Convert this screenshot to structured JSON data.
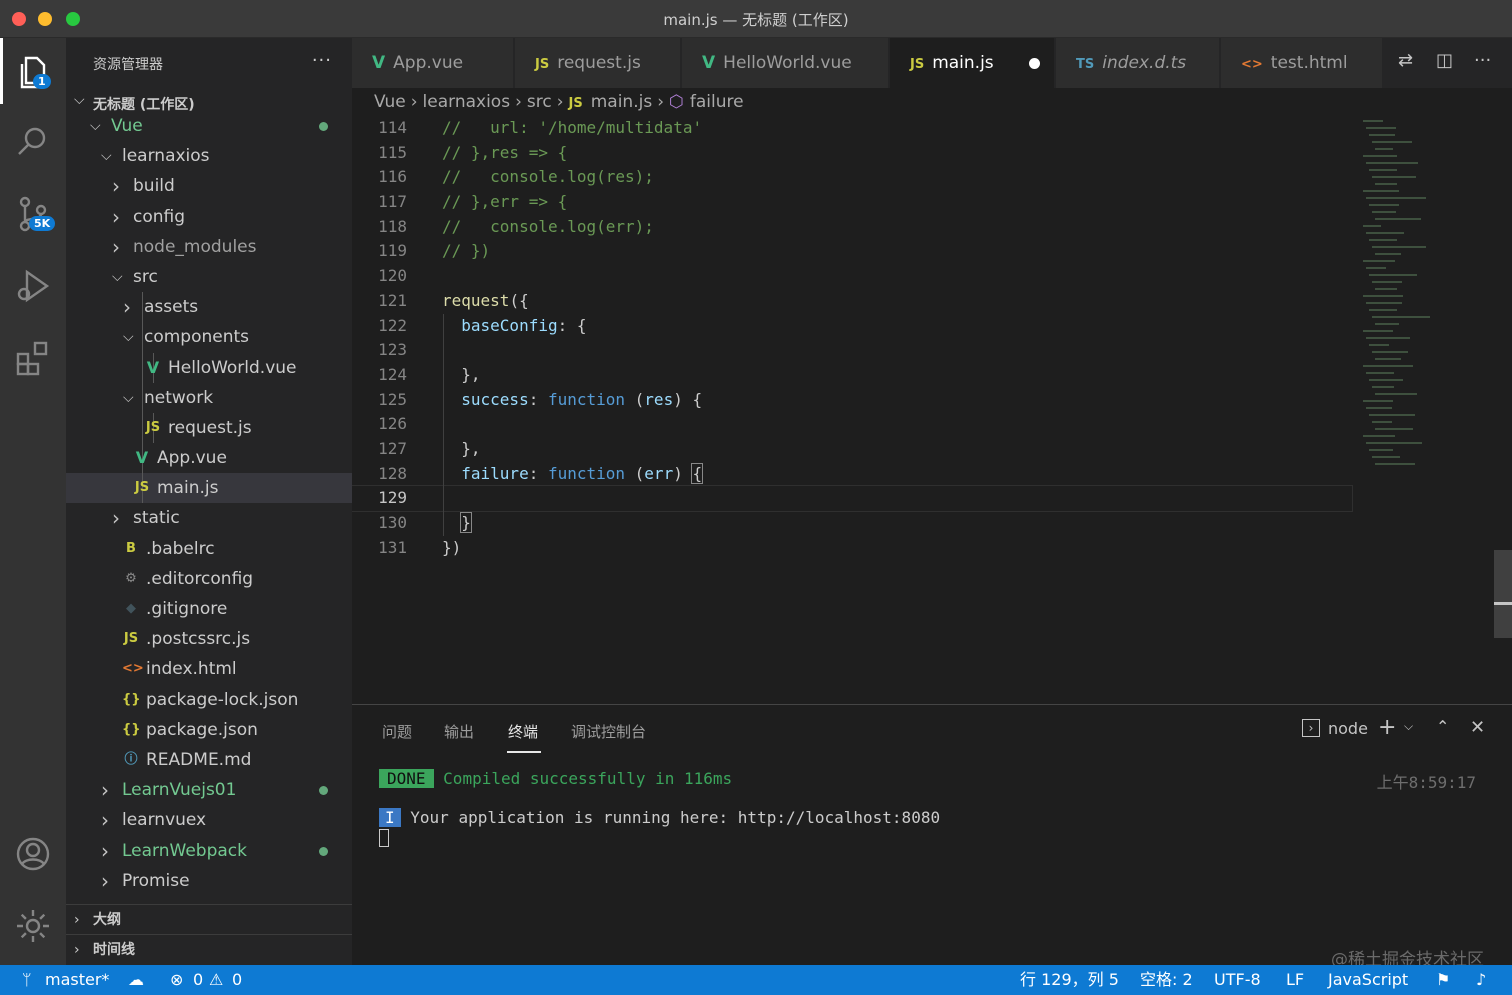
{
  "window": {
    "title": "main.js — 无标题 (工作区)"
  },
  "activity": {
    "explorer_badge": "1",
    "scm_badge": "5K"
  },
  "sidebar": {
    "title": "资源管理器",
    "more": "···",
    "workspace": "无标题 (工作区)",
    "tree": [
      {
        "label": "Vue",
        "chev": "down",
        "color": "green",
        "dot": true
      },
      {
        "label": "learnaxios",
        "chev": "down"
      },
      {
        "label": "build",
        "chev": "right"
      },
      {
        "label": "config",
        "chev": "right"
      },
      {
        "label": "node_modules",
        "chev": "right",
        "color": "dim"
      },
      {
        "label": "src",
        "chev": "down"
      },
      {
        "label": "assets",
        "chev": "right"
      },
      {
        "label": "components",
        "chev": "down"
      },
      {
        "label": "HelloWorld.vue",
        "icon": "vue-icon"
      },
      {
        "label": "network",
        "chev": "down"
      },
      {
        "label": "request.js",
        "icon": "js-icon"
      },
      {
        "label": "App.vue",
        "icon": "vue-icon"
      },
      {
        "label": "main.js",
        "icon": "js-icon",
        "selected": true
      },
      {
        "label": "static",
        "chev": "right"
      },
      {
        "label": ".babelrc",
        "icon": "babel-icon"
      },
      {
        "label": ".editorconfig",
        "icon": "gear-icon"
      },
      {
        "label": ".gitignore",
        "icon": "git-icon"
      },
      {
        "label": ".postcssrc.js",
        "icon": "js-icon"
      },
      {
        "label": "index.html",
        "icon": "html-icon"
      },
      {
        "label": "package-lock.json",
        "icon": "json-icon"
      },
      {
        "label": "package.json",
        "icon": "json-icon"
      },
      {
        "label": "README.md",
        "icon": "info-icon"
      },
      {
        "label": "LearnVuejs01",
        "chev": "right",
        "color": "green",
        "dot": true
      },
      {
        "label": "learnvuex",
        "chev": "right"
      },
      {
        "label": "LearnWebpack",
        "chev": "right",
        "color": "green",
        "dot": true
      },
      {
        "label": "Promise",
        "chev": "right"
      }
    ],
    "outline": "大纲",
    "timeline": "时间线"
  },
  "tabs": [
    {
      "label": "App.vue",
      "icon": "V"
    },
    {
      "label": "request.js",
      "icon": "JS"
    },
    {
      "label": "HelloWorld.vue",
      "icon": "V"
    },
    {
      "label": "main.js",
      "icon": "JS",
      "active": true,
      "modified": true
    },
    {
      "label": "index.d.ts",
      "icon": "TS"
    },
    {
      "label": "test.html",
      "icon": "<>"
    }
  ],
  "breadcrumb": {
    "items": [
      "Vue",
      "learnaxios",
      "src",
      "main.js",
      "failure"
    ]
  },
  "editor": {
    "current_line": "129",
    "lines": [
      {
        "n": "114",
        "t": "//   url: '/home/multidata'"
      },
      {
        "n": "115",
        "t": "// },res => {"
      },
      {
        "n": "116",
        "t": "//   console.log(res);"
      },
      {
        "n": "117",
        "t": "// },err => {"
      },
      {
        "n": "118",
        "t": "//   console.log(err);"
      },
      {
        "n": "119",
        "t": "// })"
      },
      {
        "n": "120",
        "t": ""
      },
      {
        "n": "121",
        "t": "request({"
      },
      {
        "n": "122",
        "t": "  baseConfig: {"
      },
      {
        "n": "123",
        "t": ""
      },
      {
        "n": "124",
        "t": "  },"
      },
      {
        "n": "125",
        "t": "  success: function (res) {"
      },
      {
        "n": "126",
        "t": ""
      },
      {
        "n": "127",
        "t": "  },"
      },
      {
        "n": "128",
        "t": "  failure: function (err) {"
      },
      {
        "n": "129",
        "t": ""
      },
      {
        "n": "130",
        "t": "  }"
      },
      {
        "n": "131",
        "t": "})"
      }
    ]
  },
  "panel": {
    "tabs": [
      "问题",
      "输出",
      "终端",
      "调试控制台"
    ],
    "active_tab": "终端",
    "terminal_name": "node",
    "done_label": "DONE",
    "compiled": "Compiled successfully in 116ms",
    "time": "上午8:59:17",
    "info_label": "I",
    "running": "Your application is running here: http://localhost:8080"
  },
  "watermark": "@稀土掘金技术社区",
  "status": {
    "branch": "master*",
    "errors": "0",
    "warnings": "0",
    "position": "行 129，列 5",
    "spaces": "空格: 2",
    "encoding": "UTF-8",
    "eol": "LF",
    "language": "JavaScript"
  },
  "colors": {
    "accent": "#0e7ad3",
    "git_added": "#73c991",
    "vue": "#41b883",
    "js": "#cbcb41",
    "ts": "#519aba"
  }
}
